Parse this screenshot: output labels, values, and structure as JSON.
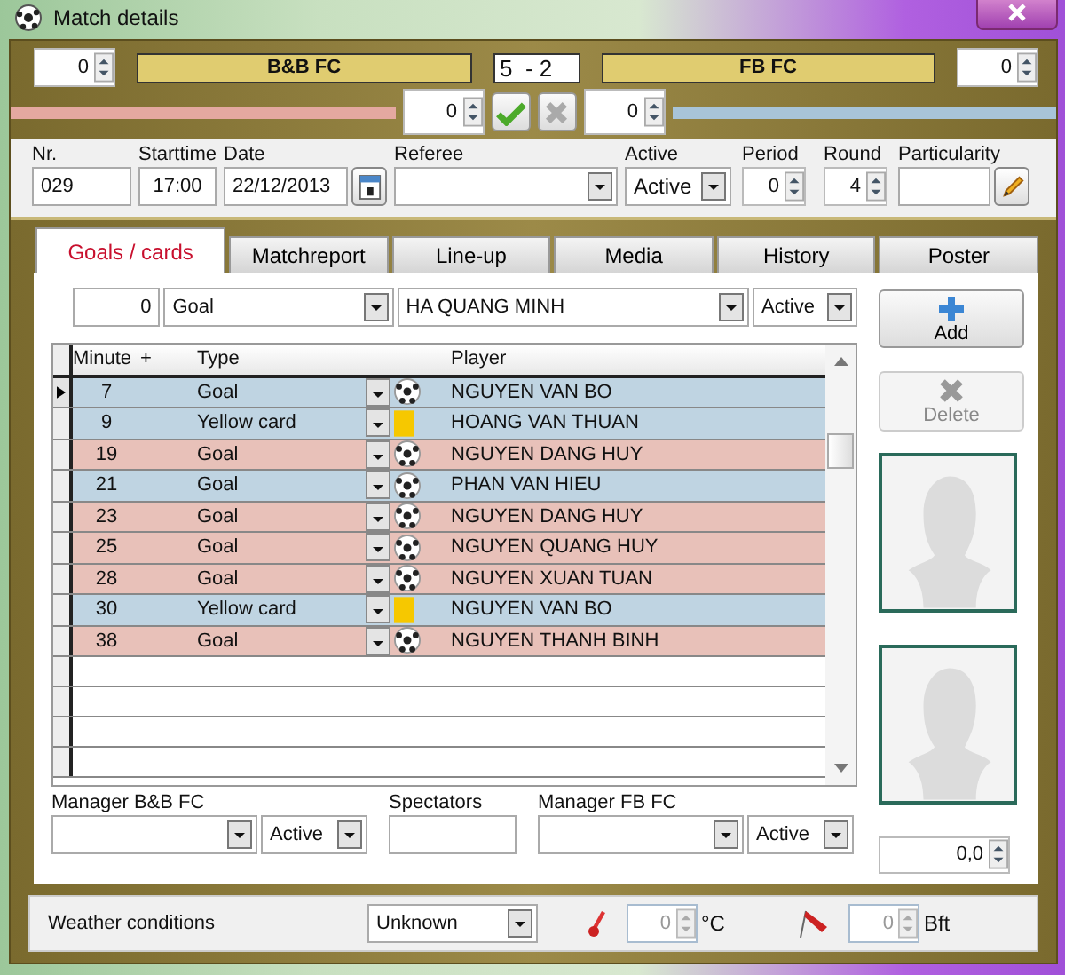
{
  "window": {
    "title": "Match details"
  },
  "header": {
    "home_team": "B&B FC",
    "away_team": "FB FC",
    "score": "5  - 2",
    "home_outer": "0",
    "away_outer": "0",
    "home_inner": "0",
    "away_inner": "0"
  },
  "match_fields": [
    {
      "kind": "text",
      "label": "Nr.",
      "value": "029"
    },
    {
      "kind": "text",
      "label": "Starttime",
      "value": "17:00"
    },
    {
      "kind": "date",
      "label": "Date",
      "value": "22/12/2013"
    },
    {
      "kind": "combo",
      "label": "Referee"
    },
    {
      "kind": "combo",
      "label": "Active",
      "value": "Active"
    },
    {
      "kind": "spin",
      "label": "Period",
      "value": "0"
    },
    {
      "kind": "spin",
      "label": "Round",
      "value": "4"
    },
    {
      "kind": "edit",
      "label": "Particularity"
    }
  ],
  "tabs": [
    {
      "label": "Goals / cards",
      "selected": true
    },
    {
      "label": "Matchreport",
      "selected": false
    },
    {
      "label": "Line-up",
      "selected": false
    },
    {
      "label": "Media",
      "selected": false
    },
    {
      "label": "History",
      "selected": false
    },
    {
      "label": "Poster",
      "selected": false
    }
  ],
  "filter": {
    "minute": "0",
    "type": "Goal",
    "player": "HA QUANG MINH",
    "status": "Active"
  },
  "table": {
    "columns": [
      "Minute",
      "+",
      "Type",
      "Player"
    ],
    "rows": [
      {
        "minute": "7",
        "type": "Goal",
        "kind": "goal",
        "player": "NGUYEN VAN BO",
        "color": "#bfd4e2",
        "selected": true
      },
      {
        "minute": "9",
        "type": "Yellow card",
        "kind": "card",
        "player": "HOANG VAN THUAN",
        "color": "#bfd4e2",
        "selected": false
      },
      {
        "minute": "19",
        "type": "Goal",
        "kind": "goal",
        "player": "NGUYEN DANG HUY",
        "color": "#e8c1b9",
        "selected": false
      },
      {
        "minute": "21",
        "type": "Goal",
        "kind": "goal",
        "player": "PHAN VAN HIEU",
        "color": "#bfd4e2",
        "selected": false
      },
      {
        "minute": "23",
        "type": "Goal",
        "kind": "goal",
        "player": "NGUYEN DANG HUY",
        "color": "#e8c1b9",
        "selected": false
      },
      {
        "minute": "25",
        "type": "Goal",
        "kind": "goal",
        "player": "NGUYEN QUANG HUY",
        "color": "#e8c1b9",
        "selected": false
      },
      {
        "minute": "28",
        "type": "Goal",
        "kind": "goal",
        "player": "NGUYEN XUAN TUAN",
        "color": "#e8c1b9",
        "selected": false
      },
      {
        "minute": "30",
        "type": "Yellow card",
        "kind": "card",
        "player": "NGUYEN VAN BO",
        "color": "#bfd4e2",
        "selected": false
      },
      {
        "minute": "38",
        "type": "Goal",
        "kind": "goal",
        "player": "NGUYEN THANH BINH",
        "color": "#e8c1b9",
        "selected": false
      }
    ]
  },
  "actions": {
    "add": "Add",
    "delete": "Delete",
    "delete_disabled": true
  },
  "managers": [
    {
      "label": "Manager B&B FC",
      "status": "Active"
    },
    {
      "label": "Manager FB FC",
      "status": "Active"
    }
  ],
  "spectators": {
    "label": "Spectators"
  },
  "rating": "0,0",
  "weather": {
    "label": "Weather conditions",
    "value": "Unknown",
    "temperature": "0",
    "temperature_unit": "°C",
    "wind": "0",
    "wind_unit": "Bft"
  }
}
